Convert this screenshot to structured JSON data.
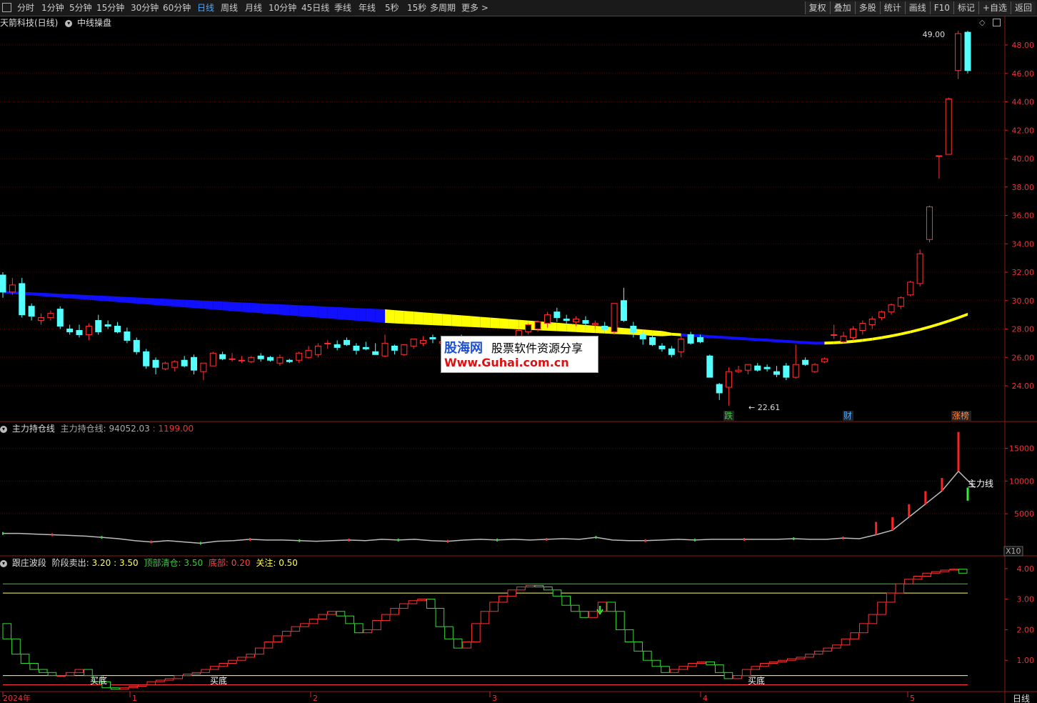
{
  "toolbar": {
    "periods": [
      "分时",
      "1分钟",
      "5分钟",
      "15分钟",
      "30分钟",
      "60分钟",
      "日线",
      "周线",
      "月线",
      "10分钟",
      "45日线",
      "季线",
      "年线",
      "5秒",
      "15秒",
      "多周期",
      "更多 >"
    ],
    "active": "日线",
    "right": [
      "复权",
      "叠加",
      "多股",
      "统计",
      "画线",
      "F10",
      "标记",
      "+自选",
      "返回"
    ]
  },
  "main_panel": {
    "stock": "天箭科技(日线)",
    "indicator": "中线操盘",
    "high_label": "49.00",
    "low_label": "22.61",
    "markers": [
      {
        "text": "跌",
        "color": "#3ec83e"
      },
      {
        "text": "财",
        "color": "#4aa8ff"
      },
      {
        "text": "涨榜",
        "color": "#ff8844"
      }
    ]
  },
  "mid_panel": {
    "name": "主力持仓线",
    "label": "主力持仓线:",
    "value": "94052.03",
    "delta": "1199.00",
    "line_label": "主力线",
    "scale": "X10"
  },
  "bot_panel": {
    "name": "跟庄波段",
    "l1": "阶段卖出:",
    "v1": "3.20",
    "v2": "3.50",
    "l2": "顶部清仓:",
    "v3": "3.50",
    "l3": "底部:",
    "v4": "0.20",
    "l4": "关注:",
    "v5": "0.50",
    "buy_labels": [
      "买底",
      "买底",
      "买底"
    ]
  },
  "xaxis": {
    "labels": [
      "2024年",
      "1",
      "2",
      "3",
      "4",
      "5"
    ],
    "right_label": "日线"
  },
  "watermark": {
    "brand": "股海网",
    "slogan": "股票软件资源分享",
    "url": "Www.Guhai.com.cn"
  },
  "chart_data": [
    {
      "type": "candlestick",
      "title": "天箭科技(日线)",
      "ylim": [
        22,
        50
      ],
      "yticks": [
        "24.00",
        "26.00",
        "28.00",
        "30.00",
        "32.00",
        "34.00",
        "36.00",
        "38.00",
        "40.00",
        "42.00",
        "44.00",
        "46.00",
        "48.00"
      ],
      "ohlc": [
        [
          31.8,
          32,
          30.2,
          30.6
        ],
        [
          30.6,
          31.6,
          30.4,
          31.1
        ],
        [
          31.2,
          31.6,
          28.8,
          29.0
        ],
        [
          29.6,
          29.8,
          28.6,
          28.9
        ],
        [
          28.6,
          29.1,
          28.3,
          28.8
        ],
        [
          28.8,
          29.3,
          28.6,
          29.1
        ],
        [
          29.4,
          29.6,
          28.0,
          28.2
        ],
        [
          28.0,
          28.3,
          27.6,
          27.8
        ],
        [
          27.9,
          28.3,
          27.4,
          27.6
        ],
        [
          27.6,
          28.4,
          27.2,
          28.2
        ],
        [
          28.6,
          29.0,
          27.6,
          27.8
        ],
        [
          28.3,
          28.6,
          28.0,
          28.2
        ],
        [
          28.2,
          28.5,
          27.7,
          27.8
        ],
        [
          27.8,
          28.1,
          27.0,
          27.2
        ],
        [
          27.2,
          27.4,
          26.2,
          26.4
        ],
        [
          26.4,
          26.6,
          25.2,
          25.4
        ],
        [
          25.8,
          26.0,
          24.8,
          25.3
        ],
        [
          25.2,
          25.7,
          25.1,
          25.6
        ],
        [
          25.3,
          25.8,
          25.0,
          25.7
        ],
        [
          25.8,
          26.1,
          25.3,
          25.4
        ],
        [
          26.0,
          26.2,
          24.8,
          25.1
        ],
        [
          25.0,
          25.6,
          24.4,
          25.6
        ],
        [
          25.4,
          26.4,
          25.4,
          26.3
        ],
        [
          26.2,
          26.4,
          25.8,
          25.9
        ],
        [
          25.9,
          26.3,
          25.7,
          25.9
        ],
        [
          25.8,
          26.1,
          25.6,
          25.8
        ],
        [
          25.7,
          26.1,
          25.6,
          26.0
        ],
        [
          26.1,
          26.3,
          25.7,
          25.9
        ],
        [
          26.0,
          26.1,
          25.7,
          25.8
        ],
        [
          25.6,
          26.2,
          25.4,
          26.0
        ],
        [
          25.8,
          25.9,
          25.6,
          25.7
        ],
        [
          25.8,
          26.4,
          25.6,
          26.3
        ],
        [
          26.0,
          26.8,
          25.9,
          26.5
        ],
        [
          26.2,
          27.0,
          26.0,
          26.8
        ],
        [
          27.0,
          27.2,
          26.6,
          27.0
        ],
        [
          26.9,
          27.2,
          26.5,
          26.7
        ],
        [
          27.2,
          27.4,
          26.8,
          26.9
        ],
        [
          26.8,
          27.0,
          26.2,
          26.5
        ],
        [
          26.7,
          27.1,
          26.5,
          26.6
        ],
        [
          26.4,
          27.0,
          26.2,
          26.2
        ],
        [
          26.1,
          27.6,
          26.0,
          27.0
        ],
        [
          26.8,
          26.9,
          26.2,
          26.5
        ],
        [
          26.2,
          26.9,
          26.1,
          26.9
        ],
        [
          26.8,
          27.3,
          26.6,
          27.3
        ],
        [
          27.0,
          27.5,
          26.8,
          27.2
        ],
        [
          27.4,
          27.6,
          27.0,
          27.3
        ],
        [
          27.0,
          27.3,
          26.8,
          27.1
        ],
        [
          27.2,
          27.5,
          26.9,
          27.0
        ],
        [
          27.4,
          27.6,
          27.1,
          27.2
        ],
        [
          26.9,
          27.2,
          26.8,
          27.0
        ],
        [
          26.8,
          27.3,
          26.6,
          27.0
        ],
        [
          27.2,
          27.5,
          26.9,
          27.1
        ],
        [
          27.0,
          27.3,
          26.8,
          26.9
        ],
        [
          27.1,
          27.4,
          26.7,
          27.3
        ],
        [
          27.3,
          28.0,
          27.2,
          27.9
        ],
        [
          27.8,
          28.4,
          27.6,
          28.3
        ],
        [
          28.0,
          28.6,
          27.8,
          28.5
        ],
        [
          28.4,
          29.2,
          28.1,
          29.0
        ],
        [
          29.2,
          29.5,
          28.5,
          28.8
        ],
        [
          28.7,
          29.0,
          28.3,
          28.6
        ],
        [
          28.5,
          28.9,
          28.2,
          28.7
        ],
        [
          28.6,
          28.9,
          28.1,
          28.4
        ],
        [
          28.3,
          28.6,
          28.0,
          28.4
        ],
        [
          28.2,
          28.5,
          27.8,
          28.0
        ],
        [
          27.8,
          29.8,
          27.6,
          29.8
        ],
        [
          30.0,
          30.9,
          28.5,
          28.6
        ],
        [
          28.2,
          28.5,
          27.4,
          27.8
        ],
        [
          27.6,
          27.8,
          26.9,
          27.3
        ],
        [
          27.4,
          27.7,
          26.8,
          26.9
        ],
        [
          26.8,
          27.0,
          26.4,
          26.6
        ],
        [
          26.6,
          26.8,
          26.0,
          26.2
        ],
        [
          26.4,
          27.6,
          26.0,
          27.3
        ],
        [
          27.6,
          27.8,
          26.9,
          27.0
        ],
        [
          27.4,
          27.6,
          27.0,
          27.1
        ],
        [
          26.1,
          26.2,
          24.6,
          24.6
        ],
        [
          24.1,
          24.2,
          23.0,
          23.5
        ],
        [
          23.9,
          25.3,
          22.6,
          25.0
        ],
        [
          25.0,
          25.4,
          24.9,
          25.1
        ],
        [
          25.1,
          25.5,
          24.8,
          25.5
        ],
        [
          25.4,
          25.6,
          25.0,
          25.1
        ],
        [
          25.3,
          25.5,
          25.0,
          25.2
        ],
        [
          25.0,
          25.4,
          24.6,
          24.8
        ],
        [
          25.4,
          25.6,
          24.4,
          24.6
        ],
        [
          24.6,
          26.9,
          24.5,
          25.5
        ],
        [
          25.8,
          26.0,
          25.4,
          25.5
        ],
        [
          25.0,
          25.6,
          24.9,
          25.5
        ],
        [
          25.7,
          26.0,
          25.6,
          25.9
        ],
        [
          27.6,
          28.3,
          27.3,
          27.6
        ],
        [
          27.1,
          27.8,
          27.0,
          27.5
        ],
        [
          27.4,
          28.2,
          27.2,
          28.0
        ],
        [
          27.9,
          28.6,
          27.6,
          28.4
        ],
        [
          28.3,
          28.9,
          28.0,
          28.7
        ],
        [
          28.8,
          29.3,
          28.6,
          29.2
        ],
        [
          29.2,
          29.8,
          29.0,
          29.7
        ],
        [
          29.6,
          30.3,
          29.4,
          30.2
        ],
        [
          30.4,
          31.4,
          30.3,
          31.3
        ],
        [
          31.2,
          33.6,
          31.0,
          33.3
        ],
        [
          34.3,
          36.7,
          34.1,
          36.6
        ],
        [
          40.2,
          40.2,
          38.6,
          40.2
        ],
        [
          40.3,
          44.3,
          40.3,
          44.2
        ],
        [
          46.2,
          49.0,
          45.6,
          48.8
        ],
        [
          48.9,
          49.0,
          46.0,
          46.2
        ]
      ],
      "band": {
        "colors": [
          "#0000ff",
          "#ffff00"
        ]
      }
    },
    {
      "type": "line",
      "title": "主力持仓线",
      "ylim": [
        0,
        18000
      ],
      "yticks": [
        "5000",
        "10000",
        "15000"
      ],
      "series": [
        {
          "name": "主力线",
          "values": [
            2000,
            2000,
            1900,
            1800,
            1700,
            1600,
            1400,
            1200,
            900,
            700,
            900,
            700,
            500,
            800,
            900,
            1100,
            1000,
            1000,
            900,
            800,
            900,
            1000,
            900,
            1100,
            1000,
            1100,
            900,
            800,
            1000,
            1100,
            1000,
            1100,
            1000,
            1100,
            1200,
            1100,
            1400,
            1000,
            900,
            900,
            1000,
            1100,
            1000,
            1100,
            1100,
            1100,
            1100,
            1100,
            1200,
            1100,
            1100,
            1300,
            1200,
            1800,
            2500,
            4500,
            6500,
            8500,
            11500,
            9000
          ]
        }
      ]
    },
    {
      "type": "line",
      "title": "跟庄波段",
      "ylim": [
        0,
        4.3
      ],
      "yticks": [
        "1.00",
        "2.00",
        "3.00",
        "4.00"
      ],
      "hlines": {
        "阶段卖出": [
          3.2,
          3.5
        ],
        "顶部清仓": 3.5,
        "底部": 0.2,
        "关注": 0.5
      },
      "series": [
        {
          "name": "跟庄波段",
          "values": [
            2.2,
            1.7,
            1.2,
            0.9,
            0.7,
            0.6,
            0.5,
            0.5,
            0.6,
            0.7,
            0.5,
            0.3,
            0.1,
            0.05,
            0.1,
            0.15,
            0.2,
            0.3,
            0.35,
            0.4,
            0.5,
            0.55,
            0.6,
            0.7,
            0.8,
            0.9,
            1.0,
            1.1,
            1.2,
            1.4,
            1.6,
            1.8,
            1.95,
            2.1,
            2.2,
            2.35,
            2.5,
            2.6,
            2.45,
            2.2,
            1.9,
            2.0,
            2.3,
            2.5,
            2.7,
            2.85,
            2.95,
            3.0,
            2.7,
            2.1,
            1.7,
            1.4,
            1.6,
            2.2,
            2.6,
            2.9,
            3.1,
            3.3,
            3.4,
            3.45,
            3.4,
            3.3,
            3.1,
            2.8,
            2.6,
            2.4,
            2.6,
            2.9,
            2.6,
            2.0,
            1.6,
            1.3,
            1.0,
            0.8,
            0.6,
            0.7,
            0.8,
            0.9,
            0.95,
            0.85,
            0.6,
            0.4,
            0.5,
            0.7,
            0.8,
            0.9,
            0.95,
            1.0,
            1.05,
            1.1,
            1.2,
            1.3,
            1.4,
            1.5,
            1.7,
            1.9,
            2.2,
            2.5,
            2.9,
            3.2,
            3.5,
            3.65,
            3.75,
            3.85,
            3.9,
            3.95,
            3.98,
            3.85
          ]
        }
      ]
    }
  ]
}
